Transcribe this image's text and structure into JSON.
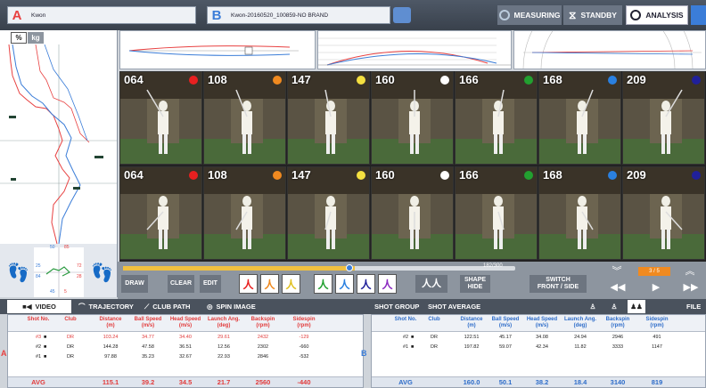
{
  "colors": {
    "accent_a": "#e84040",
    "accent_b": "#3b7dd8",
    "red_text": "#e23a3a",
    "blue_text": "#2d6cc9"
  },
  "player_a": {
    "letter": "A",
    "name": "Kwon"
  },
  "player_b": {
    "letter": "B",
    "name": "Kwon-20160520_100859-NO BRAND"
  },
  "top_buttons": {
    "measuring": "MEASURING",
    "standby": "STANDBY",
    "analysis": "ANALYSIS"
  },
  "units": {
    "percent": "%",
    "kg": "kg"
  },
  "foot_numbers": {
    "n1": "50",
    "n2": "85",
    "n3": "25",
    "n4": "72",
    "n5": "84",
    "n6": "28",
    "n7": "45",
    "n8": "5"
  },
  "frames_top": [
    {
      "num": "064",
      "dot": "#e82020"
    },
    {
      "num": "108",
      "dot": "#f08a20"
    },
    {
      "num": "147",
      "dot": "#f4e040"
    },
    {
      "num": "160",
      "dot": "#ffffff"
    },
    {
      "num": "166",
      "dot": "#22a030"
    },
    {
      "num": "168",
      "dot": "#2a80e0"
    },
    {
      "num": "209",
      "dot": "#20209a"
    }
  ],
  "frames_bottom": [
    {
      "num": "064",
      "dot": "#e82020"
    },
    {
      "num": "108",
      "dot": "#f08a20"
    },
    {
      "num": "147",
      "dot": "#f4e040"
    },
    {
      "num": "160",
      "dot": "#ffffff"
    },
    {
      "num": "166",
      "dot": "#22a030"
    },
    {
      "num": "168",
      "dot": "#2a80e0"
    },
    {
      "num": "209",
      "dot": "#20209a"
    }
  ],
  "controls": {
    "frame_counter": "182/300",
    "draw": "DRAW",
    "clear": "CLEAR",
    "edit": "EDIT",
    "shape_hide": "SHAPE\nHIDE",
    "switch": "SWITCH\nFRONT / SIDE",
    "page": "3 / 5"
  },
  "tabs": {
    "video": "VIDEO",
    "trajectory": "TRAJECTORY",
    "club_path": "CLUB PATH",
    "spin_image": "SPIN IMAGE",
    "shot_group": "SHOT GROUP",
    "shot_average": "SHOT AVERAGE",
    "file": "FILE"
  },
  "headers": [
    "Shot No.",
    "Club",
    "Distance\n(m)",
    "Ball Speed\n(m/s)",
    "Head Speed\n(m/s)",
    "Launch Ang.\n(deg)",
    "Backspin\n(rpm)",
    "Sidespin\n(rpm)"
  ],
  "table_a": {
    "side_label": "A",
    "rows": [
      {
        "shot": "#3",
        "club": "DR",
        "distance": "103.24",
        "ball": "34.77",
        "head": "34.40",
        "launch": "29.61",
        "back": "2432",
        "side": "-129"
      },
      {
        "shot": "#2",
        "club": "DR",
        "distance": "144.28",
        "ball": "47.58",
        "head": "36.51",
        "launch": "12.56",
        "back": "2302",
        "side": "-660"
      },
      {
        "shot": "#1",
        "club": "DR",
        "distance": "97.88",
        "ball": "35.23",
        "head": "32.67",
        "launch": "22.93",
        "back": "2846",
        "side": "-532"
      }
    ],
    "avg": {
      "label": "AVG",
      "distance": "115.1",
      "ball": "39.2",
      "head": "34.5",
      "launch": "21.7",
      "back": "2560",
      "side": "-440"
    }
  },
  "table_b": {
    "side_label": "B",
    "rows": [
      {
        "shot": "#2",
        "club": "DR",
        "distance": "122.51",
        "ball": "45.17",
        "head": "34.08",
        "launch": "24.94",
        "back": "2946",
        "side": "491"
      },
      {
        "shot": "#1",
        "club": "DR",
        "distance": "197.82",
        "ball": "59.07",
        "head": "42.34",
        "launch": "11.82",
        "back": "3333",
        "side": "1147"
      }
    ],
    "avg": {
      "label": "AVG",
      "distance": "160.0",
      "ball": "50.1",
      "head": "38.2",
      "launch": "18.4",
      "back": "3140",
      "side": "819"
    }
  }
}
